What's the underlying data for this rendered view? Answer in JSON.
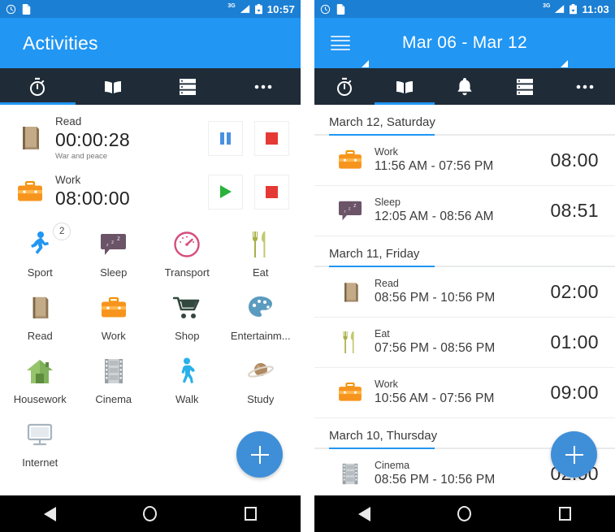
{
  "left": {
    "statusbar": {
      "time": "10:57",
      "network": "3G",
      "alarm_icon": "alarm-clock-icon",
      "sdcard_icon": "sd-card-icon",
      "signal_icon": "signal-bars-icon",
      "battery_icon": "battery-icon"
    },
    "appbar": {
      "title": "Activities"
    },
    "tabs": [
      {
        "name": "tab-timers",
        "icon": "stopwatch-icon",
        "active": true
      },
      {
        "name": "tab-log",
        "icon": "book-icon",
        "active": false
      },
      {
        "name": "tab-list",
        "icon": "list-icon",
        "active": false
      },
      {
        "name": "tab-more",
        "icon": "overflow-dots-icon",
        "active": false
      }
    ],
    "running": [
      {
        "icon": "book-icon",
        "name": "Read",
        "time": "00:00:28",
        "note": "War and peace",
        "primary_action": "pause",
        "secondary_action": "stop"
      },
      {
        "icon": "briefcase-icon",
        "name": "Work",
        "time": "08:00:00",
        "note": "",
        "primary_action": "play",
        "secondary_action": "stop"
      }
    ],
    "grid": [
      {
        "icon": "runner-icon",
        "label": "Sport",
        "badge": "2"
      },
      {
        "icon": "sleep-bubble-icon",
        "label": "Sleep",
        "badge": ""
      },
      {
        "icon": "speedometer-icon",
        "label": "Transport",
        "badge": ""
      },
      {
        "icon": "fork-knife-icon",
        "label": "Eat",
        "badge": ""
      },
      {
        "icon": "book-icon",
        "label": "Read",
        "badge": ""
      },
      {
        "icon": "briefcase-icon",
        "label": "Work",
        "badge": ""
      },
      {
        "icon": "shopping-cart-icon",
        "label": "Shop",
        "badge": ""
      },
      {
        "icon": "palette-icon",
        "label": "Entertainm...",
        "badge": ""
      },
      {
        "icon": "house-icon",
        "label": "Housework",
        "badge": ""
      },
      {
        "icon": "film-strip-icon",
        "label": "Cinema",
        "badge": ""
      },
      {
        "icon": "walking-icon",
        "label": "Walk",
        "badge": ""
      },
      {
        "icon": "planet-icon",
        "label": "Study",
        "badge": ""
      },
      {
        "icon": "monitor-icon",
        "label": "Internet",
        "badge": ""
      }
    ],
    "fab": {
      "name": "add-activity-button",
      "icon": "plus-icon"
    },
    "navbar": {
      "back": "back-triangle-icon",
      "home": "home-circle-icon",
      "recents": "recents-square-icon"
    }
  },
  "right": {
    "statusbar": {
      "time": "11:03",
      "network": "3G",
      "alarm_icon": "alarm-clock-icon",
      "sdcard_icon": "sd-card-icon",
      "signal_icon": "signal-bars-icon",
      "battery_icon": "battery-icon"
    },
    "appbar": {
      "title": "Mar 06 - Mar 12",
      "menu_icon": "hamburger-menu-icon",
      "prev_icon": "prev-period-arrow",
      "next_icon": "next-period-arrow"
    },
    "tabs": [
      {
        "name": "tab-timers",
        "icon": "stopwatch-icon",
        "active": false
      },
      {
        "name": "tab-log",
        "icon": "book-icon",
        "active": true
      },
      {
        "name": "tab-alerts",
        "icon": "bell-icon",
        "active": false
      },
      {
        "name": "tab-list",
        "icon": "list-icon",
        "active": false
      },
      {
        "name": "tab-more",
        "icon": "overflow-dots-icon",
        "active": false
      }
    ],
    "days": [
      {
        "header": "March 12, Saturday",
        "entries": [
          {
            "icon": "briefcase-icon",
            "name": "Work",
            "range": "11:56 AM - 07:56 PM",
            "duration": "08:00"
          },
          {
            "icon": "sleep-bubble-icon",
            "name": "Sleep",
            "range": "12:05 AM - 08:56 AM",
            "duration": "08:51"
          }
        ]
      },
      {
        "header": "March 11, Friday",
        "entries": [
          {
            "icon": "book-icon",
            "name": "Read",
            "range": "08:56 PM - 10:56 PM",
            "duration": "02:00"
          },
          {
            "icon": "fork-knife-icon",
            "name": "Eat",
            "range": "07:56 PM - 08:56 PM",
            "duration": "01:00"
          },
          {
            "icon": "briefcase-icon",
            "name": "Work",
            "range": "10:56 AM - 07:56 PM",
            "duration": "09:00"
          }
        ]
      },
      {
        "header": "March 10, Thursday",
        "entries": [
          {
            "icon": "film-strip-icon",
            "name": "Cinema",
            "range": "08:56 PM - 10:56 PM",
            "duration": "02:00"
          }
        ]
      }
    ],
    "fab": {
      "name": "add-record-button",
      "icon": "plus-icon"
    },
    "navbar": {
      "back": "back-triangle-icon",
      "home": "home-circle-icon",
      "recents": "recents-square-icon"
    }
  },
  "colors": {
    "status_bar": "#1b7fd4",
    "app_bar": "#2196f3",
    "tab_bar": "#1f2c38",
    "accent": "#2196f3",
    "fab": "#3f8fd8",
    "stop_red": "#e53935",
    "play_green": "#29b33c",
    "pause_blue": "#4a90e2"
  }
}
